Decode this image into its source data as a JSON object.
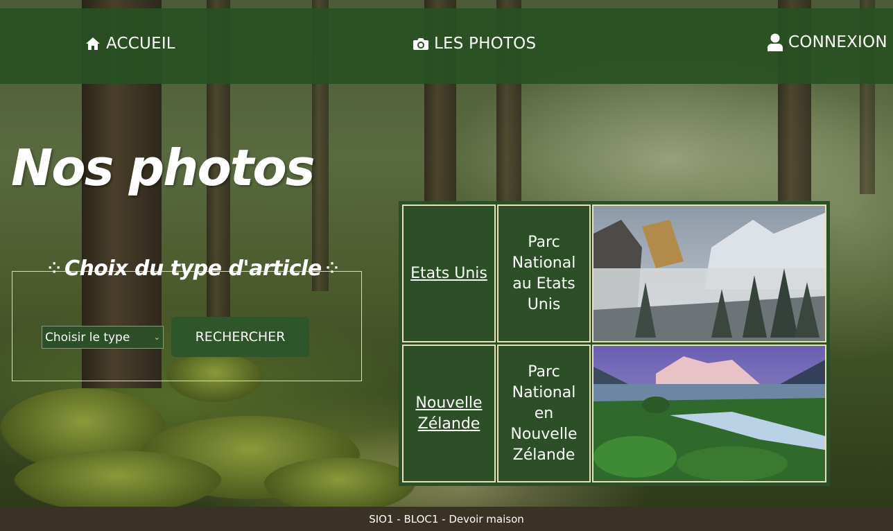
{
  "nav": {
    "home_label": "ACCUEIL",
    "photos_label": "LES PHOTOS",
    "login_label": "CONNEXION",
    "home_icon": "home-icon",
    "photos_icon": "camera-icon",
    "login_icon": "user-icon"
  },
  "page": {
    "title": "Nos photos"
  },
  "filter": {
    "legend": "Choix du type d'article",
    "select_value": "Choisir le type",
    "search_label": "RECHERCHER"
  },
  "table": {
    "rows": [
      {
        "country": "Etats Unis",
        "park": "Parc National au Etats Unis"
      },
      {
        "country": "Nouvelle Zélande",
        "park": "Parc National en Nouvelle Zélande"
      }
    ]
  },
  "footer": {
    "text": "SIO1 - BLOC1 - Devoir maison"
  },
  "colors": {
    "nav_bg": "#285023",
    "table_bg": "#2d4f28",
    "button_bg": "#2f552a",
    "cell_border": "#e8e2b8",
    "footer_bg": "#3b3226"
  }
}
